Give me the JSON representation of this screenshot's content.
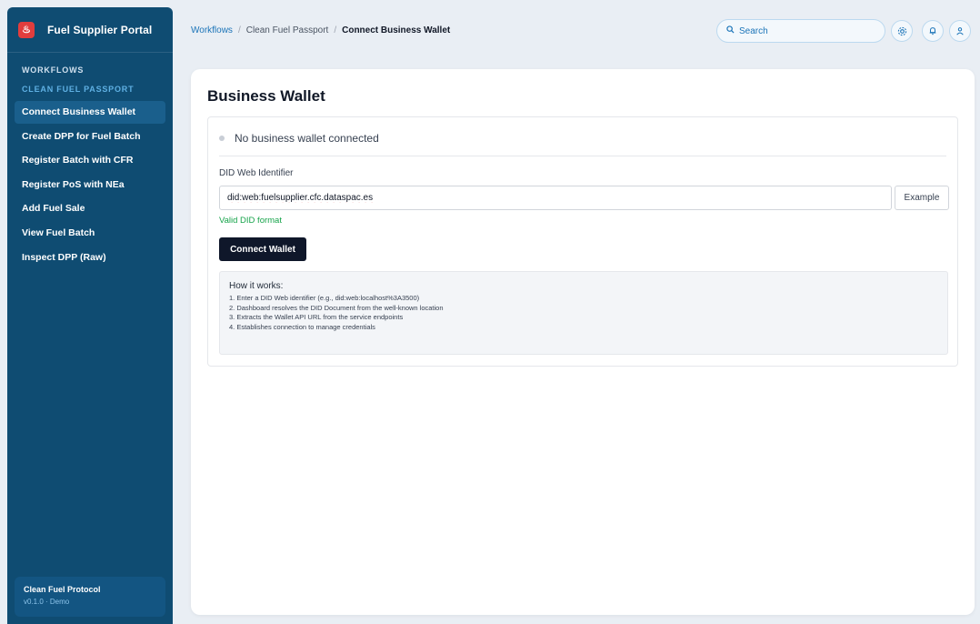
{
  "app": {
    "title": "Fuel Supplier Portal",
    "logo_glyph": "♨"
  },
  "sidebar": {
    "section_label": "WORKFLOWS",
    "group_label": "CLEAN FUEL PASSPORT",
    "items": [
      {
        "label": "Connect Business Wallet",
        "active": true
      },
      {
        "label": "Create DPP for Fuel Batch",
        "active": false
      },
      {
        "label": "Register Batch with CFR",
        "active": false
      },
      {
        "label": "Register PoS with NEa",
        "active": false
      },
      {
        "label": "Add Fuel Sale",
        "active": false
      },
      {
        "label": "View Fuel Batch",
        "active": false
      },
      {
        "label": "Inspect DPP (Raw)",
        "active": false
      }
    ],
    "footer": {
      "title": "Clean Fuel Protocol",
      "version": "v0.1.0 · Demo"
    }
  },
  "header": {
    "breadcrumb": {
      "root": "Workflows",
      "section": "Clean Fuel Passport",
      "current": "Connect Business Wallet",
      "separator": "/"
    },
    "search": {
      "placeholder": "Search",
      "icon": "search-icon"
    },
    "icons": [
      "settings-icon",
      "bell-icon",
      "user-icon"
    ]
  },
  "main": {
    "title": "Business Wallet",
    "status_text": "No business wallet connected",
    "field_label": "DID Web Identifier",
    "did_value": "did:web:fuelsupplier.cfc.dataspac.es",
    "example_label": "Example",
    "valid_text": "Valid DID format",
    "connect_label": "Connect Wallet",
    "how_it_works": {
      "title": "How it works:",
      "steps": [
        "1. Enter a DID Web identifier (e.g., did:web:localhost%3A3500)",
        "2. Dashboard resolves the DID Document from the well-known location",
        "3. Extracts the Wallet API URL from the service endpoints",
        "4. Establishes connection to manage credentials"
      ]
    }
  },
  "colors": {
    "sidebar_bg": "#0f4c72",
    "active_item_bg": "#1a5f8c",
    "accent": "#1b74b8",
    "valid": "#16a34a",
    "primary_button": "#0f172a"
  }
}
